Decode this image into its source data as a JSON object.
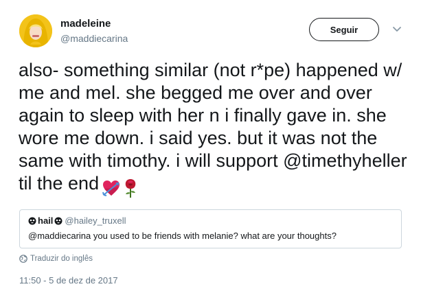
{
  "tweet": {
    "author": {
      "display_name": "madeleine",
      "handle": "@maddiecarina",
      "avatar_icon": "user-avatar-yellow-hood"
    },
    "follow_label": "Seguir",
    "more_icon": "chevron-down-icon",
    "text": "also- something similar (not r*pe) happened w/ me and mel. she begged me over and over again to sleep with her n i finally gave in. she wore me down. i said yes. but it was not the same with timothy. i will support @timethyheller til the end",
    "emojis": [
      "heart-with-arrow-emoji",
      "rose-emoji"
    ],
    "quote": {
      "name": "hail",
      "handle": "@hailey_truxell",
      "text": "@maddiecarina you used to be friends with melanie? what are your thoughts?",
      "icons": [
        "skull-flower-icon",
        "skull-flower-icon"
      ]
    },
    "translate_label": "Traduzir do inglês",
    "translate_icon": "globe-icon",
    "timestamp": "11:50 - 5 de dez de 2017"
  },
  "colors": {
    "text": "#14171a",
    "secondary": "#657786",
    "border": "#ccd6dd",
    "avatar_bg": "#f5c61c"
  }
}
